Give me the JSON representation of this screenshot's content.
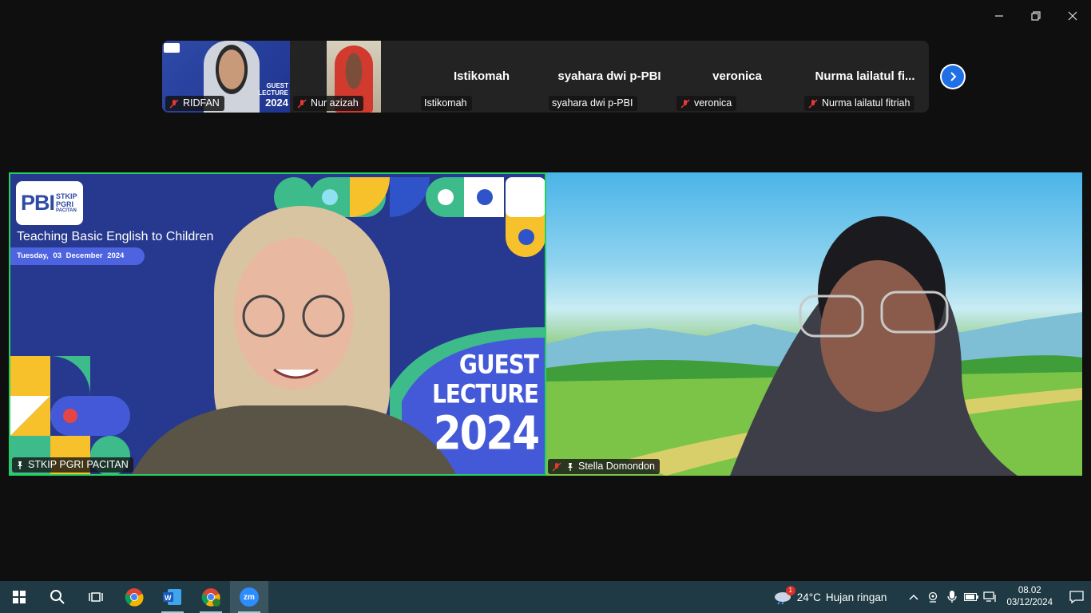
{
  "gallery": {
    "tiles": [
      {
        "name": "RIDFAN",
        "label": "RIDFAN",
        "muted": true
      },
      {
        "name": "Nur azizah",
        "label": "Nur azizah",
        "muted": true
      },
      {
        "name": "Istikomah",
        "label": "Istikomah",
        "muted": false
      },
      {
        "name": "syahara dwi p-PBI",
        "label": "syahara dwi p-PBI",
        "muted": false
      },
      {
        "name": "veronica",
        "label": "veronica",
        "muted": true
      },
      {
        "name": "Nurma lailatul fi...",
        "label": "Nurma lailatul fitriah",
        "muted": true
      }
    ],
    "thumb_text": {
      "lecture": "LECTURE",
      "year": "2024",
      "guest": "GUEST"
    }
  },
  "main": {
    "left": {
      "name_tag": "STKIP PGRI PACITAN",
      "logo": {
        "pbi": "PBI",
        "stkip": "STKIP",
        "pgri": "PGRI",
        "pacitan": "PACITAN"
      },
      "slide_title": "Teaching Basic English to Children",
      "slide_date": "Tuesday, 03 December 2024",
      "guest_line1": "GUEST",
      "guest_line2": "LECTURE",
      "guest_line3": "2024"
    },
    "right": {
      "name_tag": "Stella Domondon"
    }
  },
  "taskbar": {
    "weather_temp": "24°C",
    "weather_desc": "Hujan ringan",
    "weather_badge": "1",
    "time": "08.02",
    "date": "03/12/2024",
    "zoom_label": "zm"
  },
  "colors": {
    "accent_green": "#23d160",
    "zoom_blue": "#1f6fe5",
    "slide_blue": "#26398e",
    "taskbar": "#1f3a44"
  }
}
